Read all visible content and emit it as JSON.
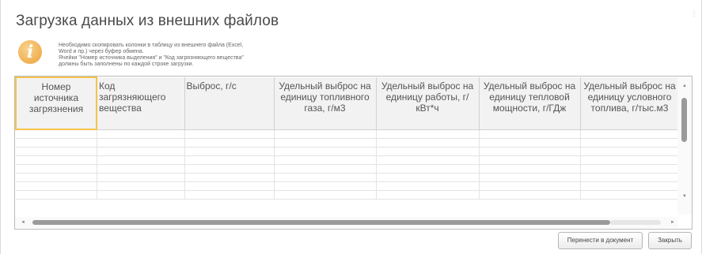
{
  "window": {
    "title": "Загрузка данных из внешних файлов",
    "corner_glyph": "⋮"
  },
  "info": {
    "icon": "i",
    "lines": [
      "Необходимо скопировать колонки в таблицу из внешнего файла (Excel,",
      "Word и пр.) через буфер обмена.",
      "Ячейки \"Номер источника выделения\" и \"Код загрязняющего вещества\"",
      "должны быть заполнены по каждой строке загрузки."
    ]
  },
  "table": {
    "columns": [
      "Номер источника загрязнения",
      "Код загрязняющего вещества",
      "Выброс, г/с",
      "Удельный выброс на единицу топливного газа, г/м3",
      "Удельный выброс на единицу работы, г/кВт*ч",
      "Удельный выброс на единицу тепловой мощности, г/ГДж",
      "Удельный выброс на единицу условного топлива, г/тыс.м3"
    ],
    "empty_row_count": 8
  },
  "scroll": {
    "up_arrow": "▲",
    "down_arrow": "▼",
    "left_arrow": "◄",
    "right_arrow": "►"
  },
  "buttons": {
    "transfer": "Перенести в документ",
    "close": "Закрыть"
  }
}
